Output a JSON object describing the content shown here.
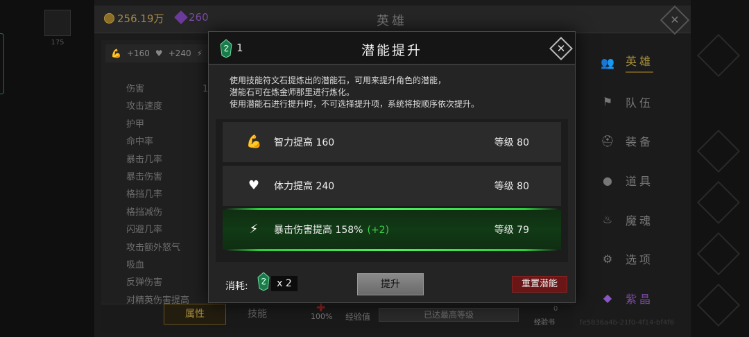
{
  "topbar": {
    "gold": "256.19万",
    "gems": "260",
    "title": "英雄"
  },
  "left_panel": {
    "portrait_level": "175",
    "stat_summary": [
      "+160",
      "+240"
    ],
    "stats": [
      "伤害",
      "攻击速度",
      "护甲",
      "命中率",
      "暴击几率",
      "暴击伤害",
      "格挡几率",
      "格挡减伤",
      "闪避几率",
      "攻击额外怒气",
      "吸血",
      "反弹伤害",
      "对精英伤害提高"
    ],
    "damage_value_partial": "1"
  },
  "bottom_bar": {
    "tab_attributes": "属性",
    "tab_skills": "技能",
    "percent": "100%",
    "exp_label": "经验值",
    "exp_value": "已达最高等级",
    "exp_book": "经验书",
    "exp_book_count": "0",
    "version": "fe5836a4b-21f0-4f14-bf4f6"
  },
  "menu": {
    "items": [
      {
        "label": "英雄",
        "icon": "hero-icon",
        "active": true
      },
      {
        "label": "队伍",
        "icon": "flag-icon"
      },
      {
        "label": "装备",
        "icon": "helmet-icon"
      },
      {
        "label": "道具",
        "icon": "bag-icon"
      },
      {
        "label": "魔魂",
        "icon": "flame-icon"
      },
      {
        "label": "选项",
        "icon": "gear-icon"
      },
      {
        "label": "紫晶",
        "icon": "crystal-icon",
        "purple": true
      }
    ]
  },
  "modal": {
    "title": "潜能提升",
    "stone_count": "1",
    "description": [
      "使用技能符文石提炼出的潜能石，可用来提升角色的潜能，",
      "潜能石可在炼金师那里进行炼化。",
      "使用潜能石进行提升时，不可选择提升项，系统将按顺序依次提升。"
    ],
    "rows": [
      {
        "icon": "strength-icon",
        "name": "智力提高 160",
        "bonus": "",
        "level": "等级 80",
        "highlight": false
      },
      {
        "icon": "heart-icon",
        "name": "体力提高 240",
        "bonus": "",
        "level": "等级 80",
        "highlight": false
      },
      {
        "icon": "lightning-icon",
        "name": "暴击伤害提高 158%",
        "bonus": "(+2)",
        "level": "等级 79",
        "highlight": true
      }
    ],
    "cost_label": "消耗:",
    "cost_amount": "x 2",
    "upgrade_button": "提升",
    "reset_button": "重置潜能"
  },
  "colors": {
    "highlight_green": "#3ad24a",
    "gold_accent": "#a8903c",
    "reset_red": "#6b1616",
    "purple": "#7a4aa3"
  }
}
